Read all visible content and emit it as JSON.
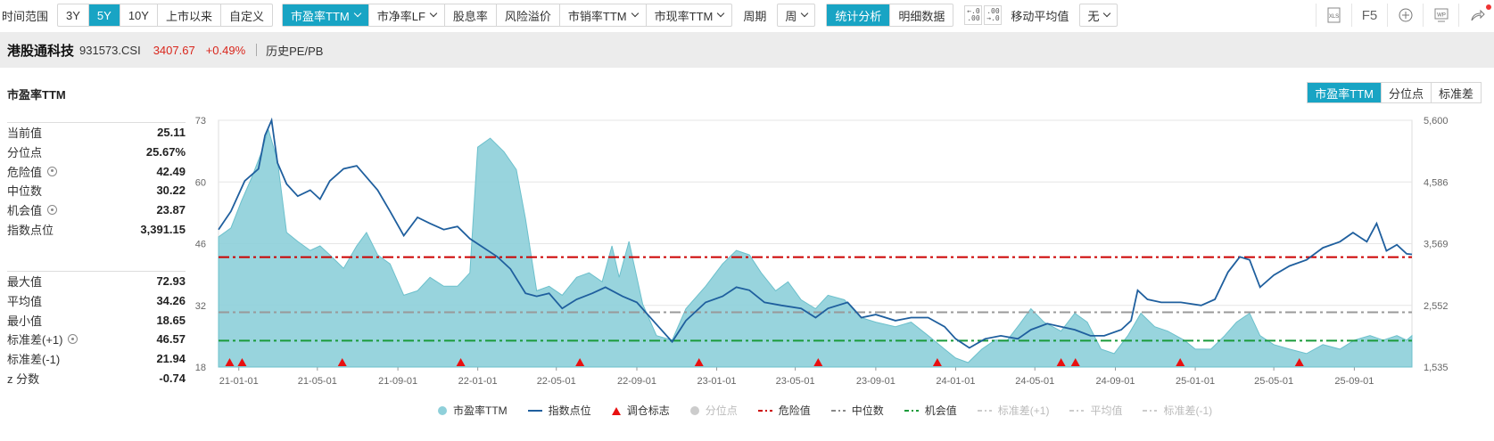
{
  "toolbar": {
    "range_label": "时间范围",
    "range_options": [
      "3Y",
      "5Y",
      "10Y",
      "上市以来",
      "自定义"
    ],
    "range_active": "5Y",
    "metric_options": [
      "市盈率TTM",
      "市净率LF",
      "股息率",
      "风险溢价",
      "市销率TTM",
      "市现率TTM"
    ],
    "metric_active": "市盈率TTM",
    "period_label": "周期",
    "period_value": "周",
    "view_options": [
      "统计分析",
      "明细数据"
    ],
    "view_active": "统计分析",
    "ma_label": "移动平均值",
    "ma_value": "无",
    "f5_label": "F5"
  },
  "info": {
    "name": "港股通科技",
    "code": "931573.CSI",
    "price": "3407.67",
    "change": "+0.49%",
    "history_link": "历史PE/PB"
  },
  "panel": {
    "title": "市盈率TTM",
    "tabs": [
      "市盈率TTM",
      "分位点",
      "标准差"
    ],
    "tab_active": "市盈率TTM",
    "stats_top": [
      {
        "k": "当前值",
        "v": "25.11",
        "gear": false
      },
      {
        "k": "分位点",
        "v": "25.67%",
        "gear": false
      },
      {
        "k": "危险值",
        "v": "42.49",
        "gear": true
      },
      {
        "k": "中位数",
        "v": "30.22",
        "gear": false
      },
      {
        "k": "机会值",
        "v": "23.87",
        "gear": true
      },
      {
        "k": "指数点位",
        "v": "3,391.15",
        "gear": false
      }
    ],
    "stats_bottom": [
      {
        "k": "最大值",
        "v": "72.93",
        "gear": false
      },
      {
        "k": "平均值",
        "v": "34.26",
        "gear": false
      },
      {
        "k": "最小值",
        "v": "18.65",
        "gear": false
      },
      {
        "k": "标准差(+1)",
        "v": "46.57",
        "gear": true
      },
      {
        "k": "标准差(-1)",
        "v": "21.94",
        "gear": false
      },
      {
        "k": "z 分数",
        "v": "-0.74",
        "gear": false
      }
    ]
  },
  "chart_data": {
    "type": "area",
    "x_ticks": [
      "21-01-01",
      "21-05-01",
      "21-09-01",
      "22-01-01",
      "22-05-01",
      "22-09-01",
      "23-01-01",
      "23-05-01",
      "23-09-01",
      "24-01-01",
      "24-05-01",
      "24-09-01",
      "25-01-01",
      "25-05-01",
      "25-09-01"
    ],
    "y_left_ticks": [
      "73",
      "60",
      "46",
      "32",
      "18"
    ],
    "y_left_range": [
      18,
      73
    ],
    "y_right_ticks": [
      "5,600",
      "4,586",
      "3,569",
      "2,552",
      "1,535"
    ],
    "y_right_range": [
      1535,
      5600
    ],
    "x_range": [
      "2020-12-01",
      "2025-11-28"
    ],
    "reference_lines": {
      "danger": 42.49,
      "median": 30.22,
      "opportunity": 23.87
    },
    "pe_series": {
      "name": "市盈率TTM",
      "points": [
        [
          "2020-12-01",
          47
        ],
        [
          "2020-12-20",
          49
        ],
        [
          "2021-01-05",
          55
        ],
        [
          "2021-01-20",
          60
        ],
        [
          "2021-02-05",
          66
        ],
        [
          "2021-02-15",
          71
        ],
        [
          "2021-03-01",
          64
        ],
        [
          "2021-03-15",
          48
        ],
        [
          "2021-04-01",
          46
        ],
        [
          "2021-04-20",
          44
        ],
        [
          "2021-05-05",
          45
        ],
        [
          "2021-05-20",
          43
        ],
        [
          "2021-06-10",
          40
        ],
        [
          "2021-06-30",
          45
        ],
        [
          "2021-07-15",
          48
        ],
        [
          "2021-08-01",
          43
        ],
        [
          "2021-08-20",
          41
        ],
        [
          "2021-09-10",
          34
        ],
        [
          "2021-10-01",
          35
        ],
        [
          "2021-10-20",
          38
        ],
        [
          "2021-11-10",
          36
        ],
        [
          "2021-12-01",
          36
        ],
        [
          "2021-12-20",
          39
        ],
        [
          "2022-01-01",
          67
        ],
        [
          "2022-01-20",
          69
        ],
        [
          "2022-02-10",
          66
        ],
        [
          "2022-03-01",
          62
        ],
        [
          "2022-03-15",
          51
        ],
        [
          "2022-04-01",
          35
        ],
        [
          "2022-04-20",
          36
        ],
        [
          "2022-05-10",
          34
        ],
        [
          "2022-06-01",
          38
        ],
        [
          "2022-06-20",
          39
        ],
        [
          "2022-07-10",
          37
        ],
        [
          "2022-07-25",
          45
        ],
        [
          "2022-08-05",
          38
        ],
        [
          "2022-08-20",
          46
        ],
        [
          "2022-09-10",
          32
        ],
        [
          "2022-10-01",
          25
        ],
        [
          "2022-10-25",
          24
        ],
        [
          "2022-11-15",
          31
        ],
        [
          "2022-12-15",
          36
        ],
        [
          "2023-01-10",
          41
        ],
        [
          "2023-01-31",
          44
        ],
        [
          "2023-02-20",
          43
        ],
        [
          "2023-03-10",
          39
        ],
        [
          "2023-04-01",
          35
        ],
        [
          "2023-04-20",
          37
        ],
        [
          "2023-05-10",
          33
        ],
        [
          "2023-06-01",
          31
        ],
        [
          "2023-06-20",
          34
        ],
        [
          "2023-07-15",
          33
        ],
        [
          "2023-08-10",
          29
        ],
        [
          "2023-09-01",
          28
        ],
        [
          "2023-10-01",
          27
        ],
        [
          "2023-10-25",
          28
        ],
        [
          "2023-11-20",
          25
        ],
        [
          "2023-12-15",
          22
        ],
        [
          "2024-01-01",
          20
        ],
        [
          "2024-01-20",
          19
        ],
        [
          "2024-02-10",
          22
        ],
        [
          "2024-03-01",
          24
        ],
        [
          "2024-03-20",
          24
        ],
        [
          "2024-04-10",
          28
        ],
        [
          "2024-04-25",
          31
        ],
        [
          "2024-05-15",
          28
        ],
        [
          "2024-06-10",
          26
        ],
        [
          "2024-07-01",
          30
        ],
        [
          "2024-07-20",
          28
        ],
        [
          "2024-08-10",
          22
        ],
        [
          "2024-08-30",
          21
        ],
        [
          "2024-09-20",
          25
        ],
        [
          "2024-10-10",
          30
        ],
        [
          "2024-10-31",
          27
        ],
        [
          "2024-11-20",
          26
        ],
        [
          "2024-12-15",
          24
        ],
        [
          "2025-01-01",
          22
        ],
        [
          "2025-01-25",
          22
        ],
        [
          "2025-02-15",
          25
        ],
        [
          "2025-03-05",
          28
        ],
        [
          "2025-03-25",
          30
        ],
        [
          "2025-04-10",
          25
        ],
        [
          "2025-05-01",
          23
        ],
        [
          "2025-05-25",
          22
        ],
        [
          "2025-06-20",
          21
        ],
        [
          "2025-07-15",
          23
        ],
        [
          "2025-08-10",
          22
        ],
        [
          "2025-09-01",
          24
        ],
        [
          "2025-09-25",
          25
        ],
        [
          "2025-10-15",
          24
        ],
        [
          "2025-11-05",
          25
        ],
        [
          "2025-11-20",
          24
        ],
        [
          "2025-11-28",
          25
        ]
      ]
    },
    "index_series": {
      "name": "指数点位",
      "points": [
        [
          "2020-12-01",
          3800
        ],
        [
          "2020-12-20",
          4100
        ],
        [
          "2021-01-10",
          4600
        ],
        [
          "2021-01-31",
          4800
        ],
        [
          "2021-02-10",
          5350
        ],
        [
          "2021-02-20",
          5600
        ],
        [
          "2021-03-01",
          4900
        ],
        [
          "2021-03-15",
          4550
        ],
        [
          "2021-04-01",
          4350
        ],
        [
          "2021-04-20",
          4450
        ],
        [
          "2021-05-05",
          4300
        ],
        [
          "2021-05-20",
          4600
        ],
        [
          "2021-06-10",
          4800
        ],
        [
          "2021-06-30",
          4850
        ],
        [
          "2021-07-20",
          4600
        ],
        [
          "2021-08-01",
          4450
        ],
        [
          "2021-08-20",
          4100
        ],
        [
          "2021-09-10",
          3700
        ],
        [
          "2021-10-01",
          4000
        ],
        [
          "2021-10-20",
          3900
        ],
        [
          "2021-11-10",
          3800
        ],
        [
          "2021-12-01",
          3850
        ],
        [
          "2021-12-20",
          3650
        ],
        [
          "2022-01-10",
          3500
        ],
        [
          "2022-01-31",
          3350
        ],
        [
          "2022-02-20",
          3150
        ],
        [
          "2022-03-15",
          2750
        ],
        [
          "2022-04-01",
          2700
        ],
        [
          "2022-04-20",
          2750
        ],
        [
          "2022-05-10",
          2500
        ],
        [
          "2022-06-01",
          2650
        ],
        [
          "2022-06-25",
          2750
        ],
        [
          "2022-07-15",
          2850
        ],
        [
          "2022-08-10",
          2700
        ],
        [
          "2022-09-01",
          2600
        ],
        [
          "2022-09-30",
          2250
        ],
        [
          "2022-10-25",
          1950
        ],
        [
          "2022-11-15",
          2300
        ],
        [
          "2022-12-15",
          2600
        ],
        [
          "2023-01-10",
          2700
        ],
        [
          "2023-01-31",
          2850
        ],
        [
          "2023-02-20",
          2800
        ],
        [
          "2023-03-15",
          2600
        ],
        [
          "2023-04-10",
          2550
        ],
        [
          "2023-05-10",
          2500
        ],
        [
          "2023-06-01",
          2350
        ],
        [
          "2023-06-20",
          2500
        ],
        [
          "2023-07-20",
          2600
        ],
        [
          "2023-08-10",
          2350
        ],
        [
          "2023-09-01",
          2400
        ],
        [
          "2023-10-01",
          2300
        ],
        [
          "2023-10-25",
          2350
        ],
        [
          "2023-11-20",
          2350
        ],
        [
          "2023-12-15",
          2200
        ],
        [
          "2024-01-01",
          2000
        ],
        [
          "2024-01-22",
          1850
        ],
        [
          "2024-02-15",
          2000
        ],
        [
          "2024-03-10",
          2050
        ],
        [
          "2024-04-05",
          2000
        ],
        [
          "2024-04-25",
          2150
        ],
        [
          "2024-05-20",
          2250
        ],
        [
          "2024-06-10",
          2200
        ],
        [
          "2024-07-01",
          2150
        ],
        [
          "2024-07-25",
          2050
        ],
        [
          "2024-08-15",
          2050
        ],
        [
          "2024-09-10",
          2150
        ],
        [
          "2024-09-25",
          2300
        ],
        [
          "2024-10-05",
          2800
        ],
        [
          "2024-10-20",
          2650
        ],
        [
          "2024-11-10",
          2600
        ],
        [
          "2024-12-10",
          2600
        ],
        [
          "2025-01-10",
          2550
        ],
        [
          "2025-01-31",
          2650
        ],
        [
          "2025-02-20",
          3100
        ],
        [
          "2025-03-10",
          3350
        ],
        [
          "2025-03-25",
          3300
        ],
        [
          "2025-04-10",
          2850
        ],
        [
          "2025-05-01",
          3050
        ],
        [
          "2025-05-25",
          3200
        ],
        [
          "2025-06-20",
          3300
        ],
        [
          "2025-07-15",
          3500
        ],
        [
          "2025-08-10",
          3600
        ],
        [
          "2025-08-30",
          3750
        ],
        [
          "2025-09-20",
          3600
        ],
        [
          "2025-10-05",
          3900
        ],
        [
          "2025-10-20",
          3450
        ],
        [
          "2025-11-05",
          3550
        ],
        [
          "2025-11-20",
          3400
        ],
        [
          "2025-11-28",
          3391
        ]
      ]
    },
    "rebalance_markers": [
      "2020-12-18",
      "2021-01-06",
      "2021-06-08",
      "2021-12-06",
      "2022-06-06",
      "2022-12-05",
      "2023-06-05",
      "2023-12-04",
      "2024-06-10",
      "2024-07-02",
      "2024-12-09",
      "2025-06-09"
    ],
    "legend": [
      {
        "label": "市盈率TTM",
        "kind": "dot",
        "color": "#8fd0da",
        "dim": false
      },
      {
        "label": "指数点位",
        "kind": "line",
        "color": "#1f5f9e",
        "dim": false
      },
      {
        "label": "调仓标志",
        "kind": "triangle",
        "color": "#e81010",
        "dim": false
      },
      {
        "label": "分位点",
        "kind": "dot",
        "color": "#cccccc",
        "dim": true
      },
      {
        "label": "危险值",
        "kind": "dashdot",
        "color": "#cc0000",
        "dim": false
      },
      {
        "label": "中位数",
        "kind": "dashdot",
        "color": "#888888",
        "dim": false
      },
      {
        "label": "机会值",
        "kind": "dashdot",
        "color": "#1a9a3a",
        "dim": false
      },
      {
        "label": "标准差(+1)",
        "kind": "dashdot",
        "color": "#cccccc",
        "dim": true
      },
      {
        "label": "平均值",
        "kind": "dashdot",
        "color": "#cccccc",
        "dim": true
      },
      {
        "label": "标准差(-1)",
        "kind": "dashdot",
        "color": "#cccccc",
        "dim": true
      }
    ],
    "colors": {
      "area_fill": "#8fd0da",
      "area_stroke": "#6cc0cc",
      "index_line": "#1f5f9e",
      "danger": "#cc0000",
      "median": "#999999",
      "opportunity": "#1a9a3a",
      "accent": "#18a4c4",
      "price_red": "#d9261c"
    }
  }
}
